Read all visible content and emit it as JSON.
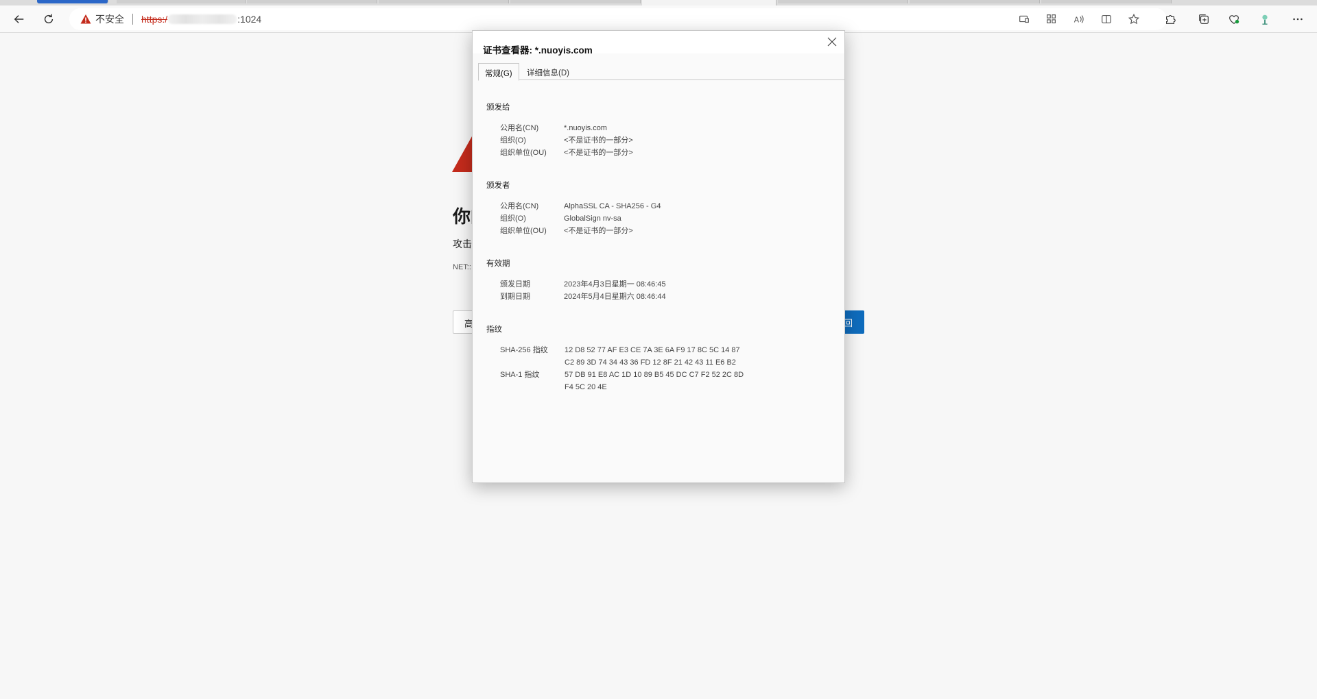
{
  "browser": {
    "insecure_label": "不安全",
    "url_scheme": "https:/",
    "url_port": ":1024"
  },
  "error_page": {
    "title": "你的",
    "body": "攻击",
    "code": "NET::",
    "advanced_label": "高",
    "back_label": "回"
  },
  "dialog": {
    "title": "证书查看器: *.nuoyis.com",
    "tabs": [
      {
        "label": "常规(G)",
        "active": true
      },
      {
        "label": "详细信息(D)",
        "active": false
      }
    ],
    "issued_to": {
      "heading": "颁发给",
      "rows": [
        {
          "label": "公用名(CN)",
          "value": "*.nuoyis.com"
        },
        {
          "label": "组织(O)",
          "value": "<不是证书的一部分>"
        },
        {
          "label": "组织单位(OU)",
          "value": "<不是证书的一部分>"
        }
      ]
    },
    "issued_by": {
      "heading": "颁发者",
      "rows": [
        {
          "label": "公用名(CN)",
          "value": "AlphaSSL CA - SHA256 - G4"
        },
        {
          "label": "组织(O)",
          "value": "GlobalSign nv-sa"
        },
        {
          "label": "组织单位(OU)",
          "value": "<不是证书的一部分>"
        }
      ]
    },
    "validity": {
      "heading": "有效期",
      "rows": [
        {
          "label": "颁发日期",
          "value": "2023年4月3日星期一 08:46:45"
        },
        {
          "label": "到期日期",
          "value": "2024年5月4日星期六 08:46:44"
        }
      ]
    },
    "fingerprints": {
      "heading": "指纹",
      "sha256_label": "SHA-256 指纹",
      "sha256_line1": "12 D8 52 77 AF E3 CE 7A 3E 6A F9 17 8C 5C 14 87",
      "sha256_line2": "C2 89 3D 74 34 43 36 FD 12 8F 21 42 43 11 E6 B2",
      "sha1_label": "SHA-1 指纹",
      "sha1_line1": "57 DB 91 E8 AC 1D 10 89 B5 45 DC C7 F2 52 2C 8D",
      "sha1_line2": "F4 5C 20 4E"
    }
  }
}
